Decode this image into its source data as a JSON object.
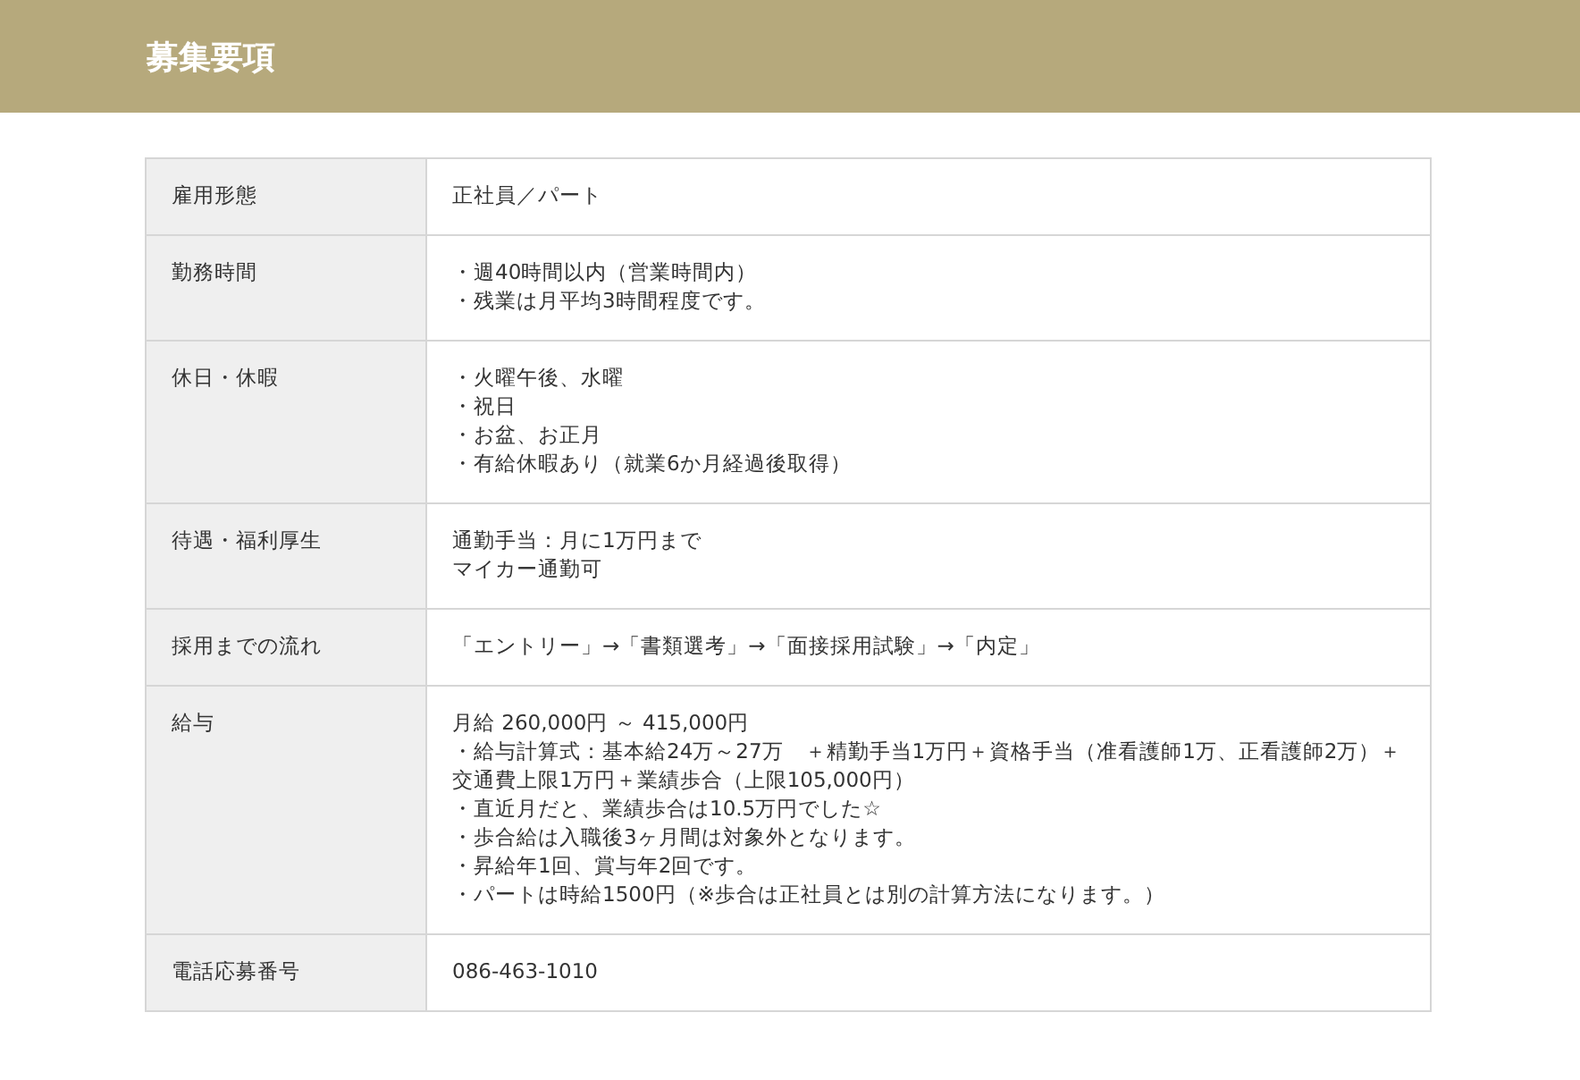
{
  "header": {
    "title": "募集要項"
  },
  "rows": [
    {
      "label": "雇用形態",
      "lines": [
        "正社員／パート"
      ]
    },
    {
      "label": "勤務時間",
      "lines": [
        "・週40時間以内（営業時間内）",
        "・残業は月平均3時間程度です。"
      ]
    },
    {
      "label": "休日・休暇",
      "lines": [
        "・火曜午後、水曜",
        "・祝日",
        "・お盆、お正月",
        "・有給休暇あり（就業6か月経過後取得）"
      ]
    },
    {
      "label": "待遇・福利厚生",
      "lines": [
        "通勤手当：月に1万円まで",
        "マイカー通勤可"
      ]
    },
    {
      "label": "採用までの流れ",
      "lines": [
        "「エントリー」→「書類選考」→「面接採用試験」→「内定」"
      ]
    },
    {
      "label": "給与",
      "lines": [
        "月給 260,000円 ～ 415,000円",
        "・給与計算式：基本給24万～27万　＋精勤手当1万円＋資格手当（准看護師1万、正看護師2万）＋交通費上限1万円＋業績歩合（上限105,000円）",
        "・直近月だと、業績歩合は10.5万円でした☆",
        "・歩合給は入職後3ヶ月間は対象外となります。",
        "・昇給年1回、賞与年2回です。",
        "・パートは時給1500円（※歩合は正社員とは別の計算方法になります。）"
      ]
    },
    {
      "label": "電話応募番号",
      "lines": [
        "086-463-1010"
      ]
    }
  ]
}
